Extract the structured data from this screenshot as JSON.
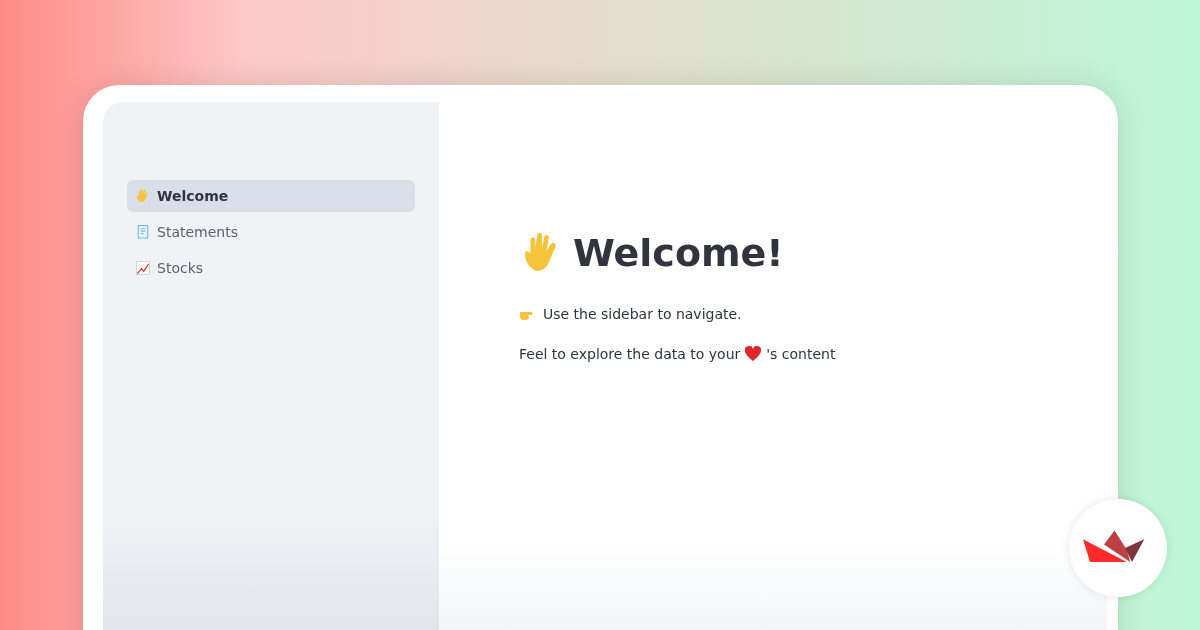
{
  "sidebar": {
    "items": [
      {
        "label": "Welcome",
        "selected": true
      },
      {
        "label": "Statements",
        "selected": false
      },
      {
        "label": "Stocks",
        "selected": false
      }
    ]
  },
  "main": {
    "title": "Welcome!",
    "hint": "Use the sidebar to navigate.",
    "note_before": "Feel to explore the data to your",
    "note_after": "'s content"
  }
}
